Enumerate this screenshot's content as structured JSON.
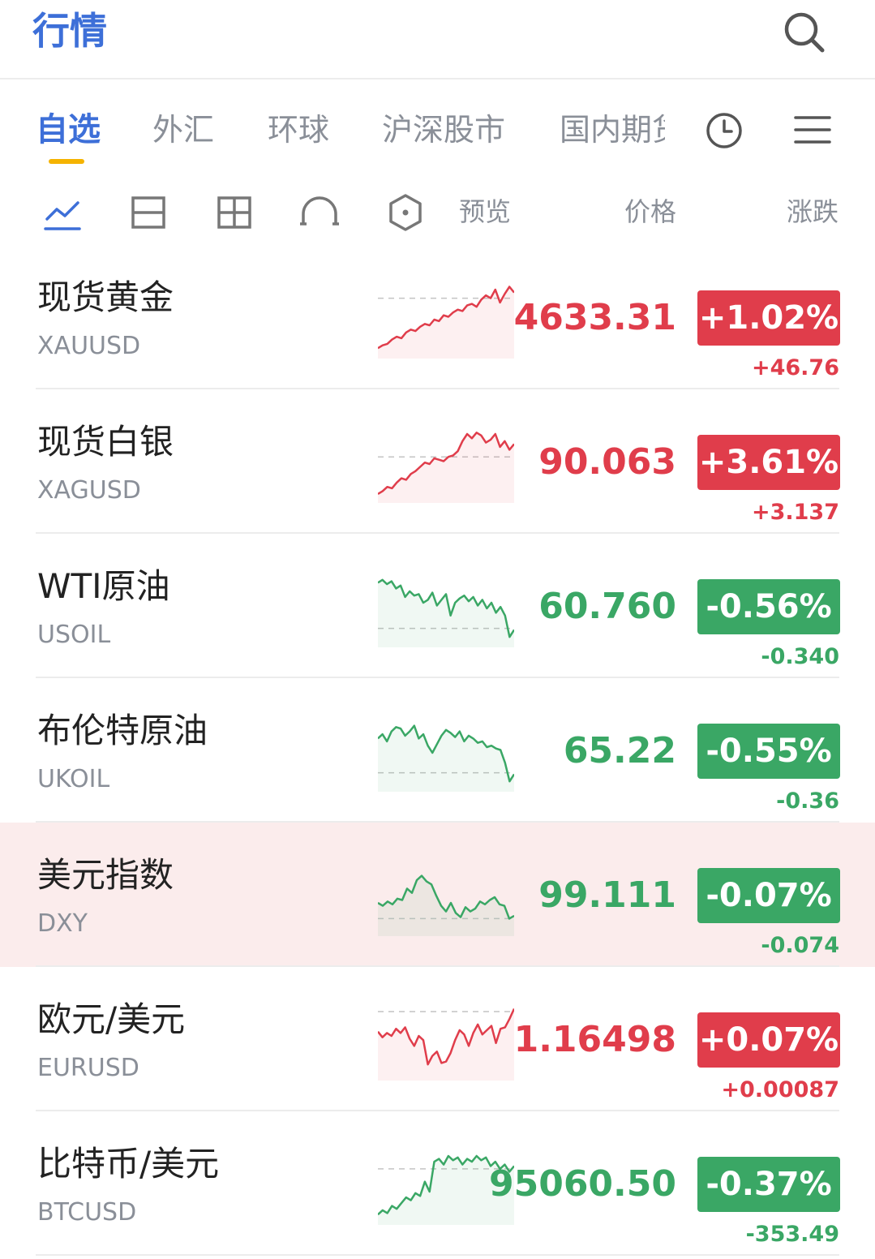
{
  "header": {
    "title": "行情",
    "search_icon": "search-icon"
  },
  "tabs": [
    {
      "label": "自选",
      "active": true
    },
    {
      "label": "外汇"
    },
    {
      "label": "环球"
    },
    {
      "label": "沪深股市"
    },
    {
      "label": "国内期货"
    }
  ],
  "toolbar_icons": {
    "clock": "clock-icon",
    "menu": "menu-icon"
  },
  "view_icons": [
    "line-chart-icon",
    "split-view-icon",
    "grid-view-icon",
    "arc-view-icon",
    "hexagon-view-icon"
  ],
  "columns": {
    "preview": "预览",
    "price": "价格",
    "change": "涨跌"
  },
  "colors": {
    "accent": "#3d6fd8",
    "up": "#e03d4b",
    "down": "#3aa765",
    "tab_indicator": "#f5b300",
    "highlight": "#fbecec"
  },
  "quotes": [
    {
      "name": "现货黄金",
      "code": "XAUUSD",
      "price": "4633.31",
      "percent": "+1.02%",
      "change": "+46.76",
      "direction": "up",
      "sparkline": [
        10,
        14,
        16,
        22,
        26,
        24,
        32,
        36,
        34,
        40,
        44,
        42,
        50,
        48,
        56,
        54,
        60,
        64,
        62,
        70,
        72,
        68,
        78,
        84,
        80,
        92,
        74,
        86,
        96,
        88
      ],
      "baseline": 80
    },
    {
      "name": "现货白银",
      "code": "XAGUSD",
      "price": "90.063",
      "percent": "+3.61%",
      "change": "+3.137",
      "direction": "up",
      "sparkline": [
        8,
        12,
        18,
        16,
        24,
        30,
        28,
        36,
        40,
        46,
        52,
        50,
        58,
        56,
        54,
        60,
        62,
        68,
        82,
        92,
        86,
        94,
        90,
        80,
        84,
        92,
        74,
        82,
        70,
        78
      ],
      "baseline": 60
    },
    {
      "name": "WTI原油",
      "code": "USOIL",
      "price": "60.760",
      "percent": "-0.56%",
      "change": "-0.340",
      "direction": "down",
      "sparkline": [
        86,
        90,
        84,
        88,
        78,
        82,
        66,
        74,
        68,
        70,
        58,
        62,
        72,
        54,
        62,
        70,
        40,
        58,
        64,
        68,
        60,
        66,
        54,
        62,
        50,
        58,
        44,
        52,
        40,
        10,
        20
      ],
      "baseline": 22
    },
    {
      "name": "布伦特原油",
      "code": "UKOIL",
      "price": "65.22",
      "percent": "-0.55%",
      "change": "-0.36",
      "direction": "down",
      "sparkline": [
        70,
        76,
        66,
        80,
        86,
        84,
        74,
        80,
        88,
        70,
        76,
        60,
        50,
        62,
        74,
        82,
        78,
        72,
        80,
        66,
        74,
        70,
        64,
        66,
        58,
        60,
        56,
        54,
        36,
        10,
        20
      ],
      "baseline": 22
    },
    {
      "name": "美元指数",
      "code": "DXY",
      "price": "99.111",
      "percent": "-0.07%",
      "change": "-0.074",
      "direction": "down",
      "sparkline": [
        42,
        38,
        44,
        40,
        48,
        46,
        62,
        56,
        74,
        80,
        72,
        68,
        52,
        38,
        30,
        42,
        28,
        22,
        36,
        30,
        34,
        44,
        40,
        46,
        50,
        40,
        38,
        20,
        24
      ],
      "baseline": 20
    },
    {
      "name": "欧元/美元",
      "code": "EURUSD",
      "price": "1.16498",
      "percent": "+0.07%",
      "change": "+0.00087",
      "direction": "up",
      "sparkline": [
        64,
        56,
        62,
        58,
        68,
        62,
        70,
        54,
        44,
        58,
        52,
        18,
        30,
        36,
        20,
        22,
        34,
        52,
        66,
        60,
        44,
        62,
        74,
        60,
        66,
        72,
        48,
        68,
        70,
        82,
        96
      ],
      "baseline": 92
    },
    {
      "name": "比特币/美元",
      "code": "BTCUSD",
      "price": "95060.50",
      "percent": "-0.37%",
      "change": "-353.49",
      "direction": "down",
      "sparkline": [
        10,
        16,
        12,
        22,
        18,
        26,
        34,
        30,
        40,
        36,
        56,
        42,
        84,
        88,
        80,
        92,
        86,
        90,
        80,
        88,
        84,
        92,
        86,
        90,
        78,
        84,
        74,
        80,
        70,
        78
      ],
      "baseline": 74
    }
  ]
}
